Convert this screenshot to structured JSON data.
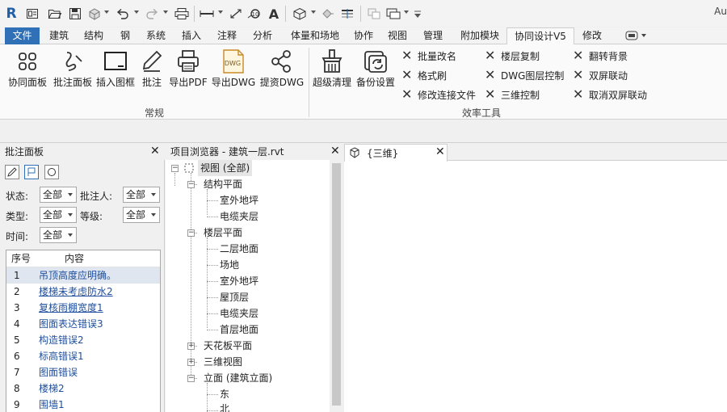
{
  "app": {
    "logo_letter": "R",
    "title_fragment": "Au"
  },
  "quick_access": {
    "icons": [
      "revit-logo-icon",
      "open-icon",
      "save-icon",
      "sync-icon",
      "undo-icon",
      "redo-icon",
      "print-icon",
      "measure-icon",
      "dimension-icon",
      "tag-icon",
      "text-icon",
      "3d-view-icon",
      "section-icon",
      "thin-lines-icon",
      "close-hidden-icon",
      "switch-windows-icon",
      "customize-icon"
    ],
    "text_tool": "A"
  },
  "tabs": [
    {
      "label": "文件",
      "kind": "file"
    },
    {
      "label": "建筑"
    },
    {
      "label": "结构"
    },
    {
      "label": "钢"
    },
    {
      "label": "系统"
    },
    {
      "label": "插入"
    },
    {
      "label": "注释"
    },
    {
      "label": "分析"
    },
    {
      "label": "体量和场地"
    },
    {
      "label": "协作"
    },
    {
      "label": "视图"
    },
    {
      "label": "管理"
    },
    {
      "label": "附加模块"
    },
    {
      "label": "协同设计V5",
      "kind": "active"
    },
    {
      "label": "修改"
    }
  ],
  "ribbon": {
    "panels": [
      {
        "title": "常规",
        "big_buttons": [
          {
            "label": "协同面板",
            "icon": "grid-dots-icon"
          },
          {
            "label": "批注面板",
            "icon": "annotate-curve-icon"
          },
          {
            "label": "插入图框",
            "icon": "frame-icon"
          },
          {
            "label": "批注",
            "icon": "pencil-icon"
          },
          {
            "label": "导出PDF",
            "icon": "printer-icon"
          },
          {
            "label": "导出DWG",
            "icon": "dwg-file-icon",
            "badge": "DWG"
          },
          {
            "label": "提资DWG",
            "icon": "share-icon"
          }
        ]
      },
      {
        "title": "效率工具",
        "big_buttons": [
          {
            "label": "超级清理",
            "icon": "broom-icon"
          },
          {
            "label": "备份设置",
            "icon": "backup-icon"
          }
        ],
        "small_buttons": [
          [
            "批量改名",
            "格式刷",
            "修改连接文件"
          ],
          [
            "楼层复制",
            "DWG图层控制",
            "三维控制"
          ],
          [
            "翻转背景",
            "双屏联动",
            "取消双屏联动"
          ]
        ]
      }
    ]
  },
  "annotation_panel": {
    "title": "批注面板",
    "tools": [
      "pencil-tool-icon",
      "flag-tool-icon",
      "lasso-tool-icon"
    ],
    "filters": {
      "status": {
        "label": "状态:",
        "value": "全部"
      },
      "author": {
        "label": "批注人:",
        "value": "全部"
      },
      "type": {
        "label": "类型:",
        "value": "全部"
      },
      "level": {
        "label": "等级:",
        "value": "全部"
      },
      "time": {
        "label": "时间:",
        "value": "全部"
      }
    },
    "list": {
      "columns": [
        "序号",
        "内容"
      ],
      "rows": [
        {
          "no": "1",
          "content": "吊顶高度应明确。",
          "selected": true,
          "underline": false
        },
        {
          "no": "2",
          "content": "楼梯未考虑防水2",
          "underline": true
        },
        {
          "no": "3",
          "content": "复核雨棚宽度1",
          "underline": true
        },
        {
          "no": "4",
          "content": "图面表达错误3",
          "underline": false
        },
        {
          "no": "5",
          "content": "构造错误2",
          "underline": false
        },
        {
          "no": "6",
          "content": "标高错误1",
          "underline": false
        },
        {
          "no": "7",
          "content": "图面错误",
          "underline": false
        },
        {
          "no": "8",
          "content": "楼梯2",
          "underline": false
        },
        {
          "no": "9",
          "content": "围墙1",
          "underline": false
        }
      ]
    }
  },
  "project_browser": {
    "title": "项目浏览器 - 建筑一层.rvt",
    "root": "视图 (全部)",
    "groups": [
      {
        "label": "结构平面",
        "expanded": true,
        "children": [
          "室外地坪",
          "电缆夹层"
        ]
      },
      {
        "label": "楼层平面",
        "expanded": true,
        "children": [
          "二层地面",
          "场地",
          "室外地坪",
          "屋顶层",
          "电缆夹层",
          "首层地面"
        ]
      },
      {
        "label": "天花板平面",
        "expanded": false,
        "children": []
      },
      {
        "label": "三维视图",
        "expanded": false,
        "children": []
      },
      {
        "label": "立面 (建筑立面)",
        "expanded": true,
        "children": [
          "东",
          "北"
        ]
      }
    ]
  },
  "view_tab": {
    "label": "{三维}"
  },
  "close_glyph": "✕"
}
